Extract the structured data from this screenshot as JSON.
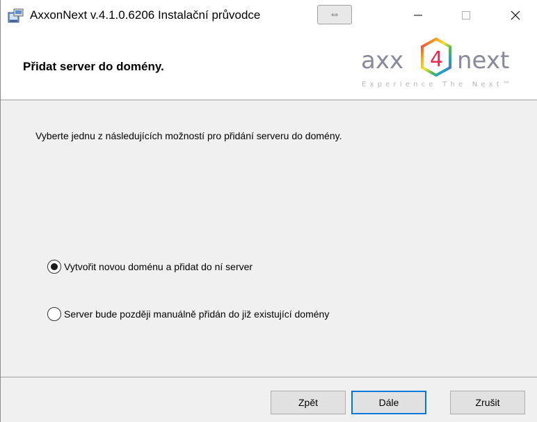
{
  "window": {
    "title": "AxxonNext v.4.1.0.6206 Instalační průvodce",
    "resize_glyph": "⇔",
    "minimize_icon": "minimize-icon",
    "maximize_icon": "maximize-icon",
    "close_icon": "close-icon"
  },
  "banner": {
    "title": "Přidat server do domény.",
    "logo": {
      "left_text": "axx",
      "digit": "4",
      "right_text": "next",
      "tagline": "Experience The Next™"
    }
  },
  "content": {
    "intro": "Vyberte jednu z následujících možností pro přidání serveru do domény.",
    "options": [
      {
        "label": "Vytvořit novou doménu a přidat do ní server",
        "selected": true
      },
      {
        "label": "Server bude později manuálně přidán do již existující domény",
        "selected": false
      }
    ]
  },
  "footer": {
    "back_label": "Zpět",
    "next_label": "Dále",
    "cancel_label": "Zrušit"
  },
  "colors": {
    "focus_border": "#0078d7",
    "logo_text": "#8a8a9a",
    "logo_hex_gradient": [
      "#e8284f",
      "#f9a11b",
      "#f5e22a",
      "#4cb848",
      "#1e9fd8",
      "#8c4a9e"
    ]
  }
}
